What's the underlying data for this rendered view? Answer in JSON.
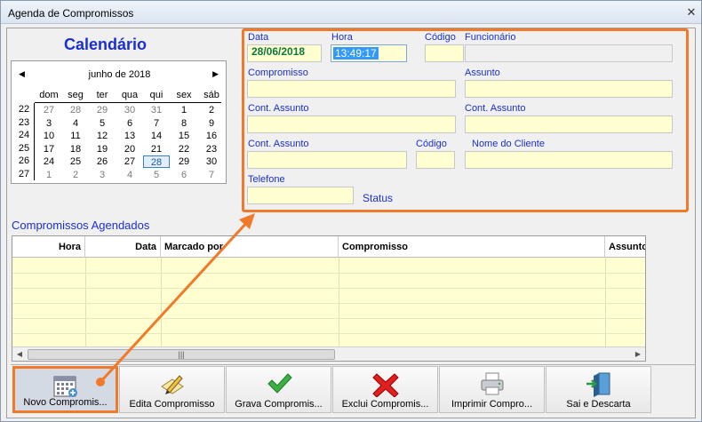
{
  "window": {
    "title": "Agenda de Compromissos",
    "close_glyph": "✕"
  },
  "calendar": {
    "title": "Calendário",
    "month_label": "junho de 2018",
    "prev_glyph": "◀",
    "next_glyph": "▶",
    "day_headers": [
      "dom",
      "seg",
      "ter",
      "qua",
      "qui",
      "sex",
      "sáb"
    ],
    "weeks": [
      {
        "num": "22",
        "days": [
          {
            "d": "27",
            "o": true
          },
          {
            "d": "28",
            "o": true
          },
          {
            "d": "29",
            "o": true
          },
          {
            "d": "30",
            "o": true
          },
          {
            "d": "31",
            "o": true
          },
          {
            "d": "1"
          },
          {
            "d": "2"
          }
        ]
      },
      {
        "num": "23",
        "days": [
          {
            "d": "3"
          },
          {
            "d": "4"
          },
          {
            "d": "5"
          },
          {
            "d": "6"
          },
          {
            "d": "7"
          },
          {
            "d": "8"
          },
          {
            "d": "9"
          }
        ]
      },
      {
        "num": "24",
        "days": [
          {
            "d": "10"
          },
          {
            "d": "11"
          },
          {
            "d": "12"
          },
          {
            "d": "13"
          },
          {
            "d": "14"
          },
          {
            "d": "15"
          },
          {
            "d": "16"
          }
        ]
      },
      {
        "num": "25",
        "days": [
          {
            "d": "17"
          },
          {
            "d": "18"
          },
          {
            "d": "19"
          },
          {
            "d": "20"
          },
          {
            "d": "21"
          },
          {
            "d": "22"
          },
          {
            "d": "23"
          }
        ]
      },
      {
        "num": "26",
        "days": [
          {
            "d": "24"
          },
          {
            "d": "25"
          },
          {
            "d": "26"
          },
          {
            "d": "27"
          },
          {
            "d": "28",
            "s": true
          },
          {
            "d": "29"
          },
          {
            "d": "30"
          }
        ]
      },
      {
        "num": "27",
        "days": [
          {
            "d": "1",
            "o": true
          },
          {
            "d": "2",
            "o": true
          },
          {
            "d": "3",
            "o": true
          },
          {
            "d": "4",
            "o": true
          },
          {
            "d": "5",
            "o": true
          },
          {
            "d": "6",
            "o": true
          },
          {
            "d": "7",
            "o": true
          }
        ]
      }
    ]
  },
  "form": {
    "data_label": "Data",
    "data_value": "28/06/2018",
    "hora_label": "Hora",
    "hora_value": "13:49:17",
    "codigo_label": "Código",
    "funcionario_label": "Funcionário",
    "compromisso_label": "Compromisso",
    "assunto_label": "Assunto",
    "cont_assunto_label_1": "Cont. Assunto",
    "cont_assunto_label_2": "Cont. Assunto",
    "cont_assunto_label_3": "Cont. Assunto",
    "codigo_cliente_label": "Código",
    "nome_cliente_label": "Nome do Cliente",
    "telefone_label": "Telefone",
    "status_label": "Status"
  },
  "agendados": {
    "label": "Compromissos Agendados",
    "columns": [
      "Hora",
      "Data",
      "Marcado por",
      "Compromisso",
      "Assunto"
    ]
  },
  "toolbar": {
    "buttons": [
      {
        "label": "Novo Compromis...",
        "icon": "calendar-new-icon"
      },
      {
        "label": "Edita Compromisso",
        "icon": "pencil-edit-icon"
      },
      {
        "label": "Grava Compromis...",
        "icon": "checkmark-icon"
      },
      {
        "label": "Exclui Compromis...",
        "icon": "red-x-icon"
      },
      {
        "label": "Imprimir Compro...",
        "icon": "printer-icon"
      },
      {
        "label": "Sai e Descarta",
        "icon": "exit-door-icon"
      }
    ]
  },
  "colors": {
    "accent_orange": "#f07a2a",
    "label_blue": "#1a2fd0",
    "field_yellow": "#ffffd2",
    "date_green": "#0a7a3a"
  }
}
